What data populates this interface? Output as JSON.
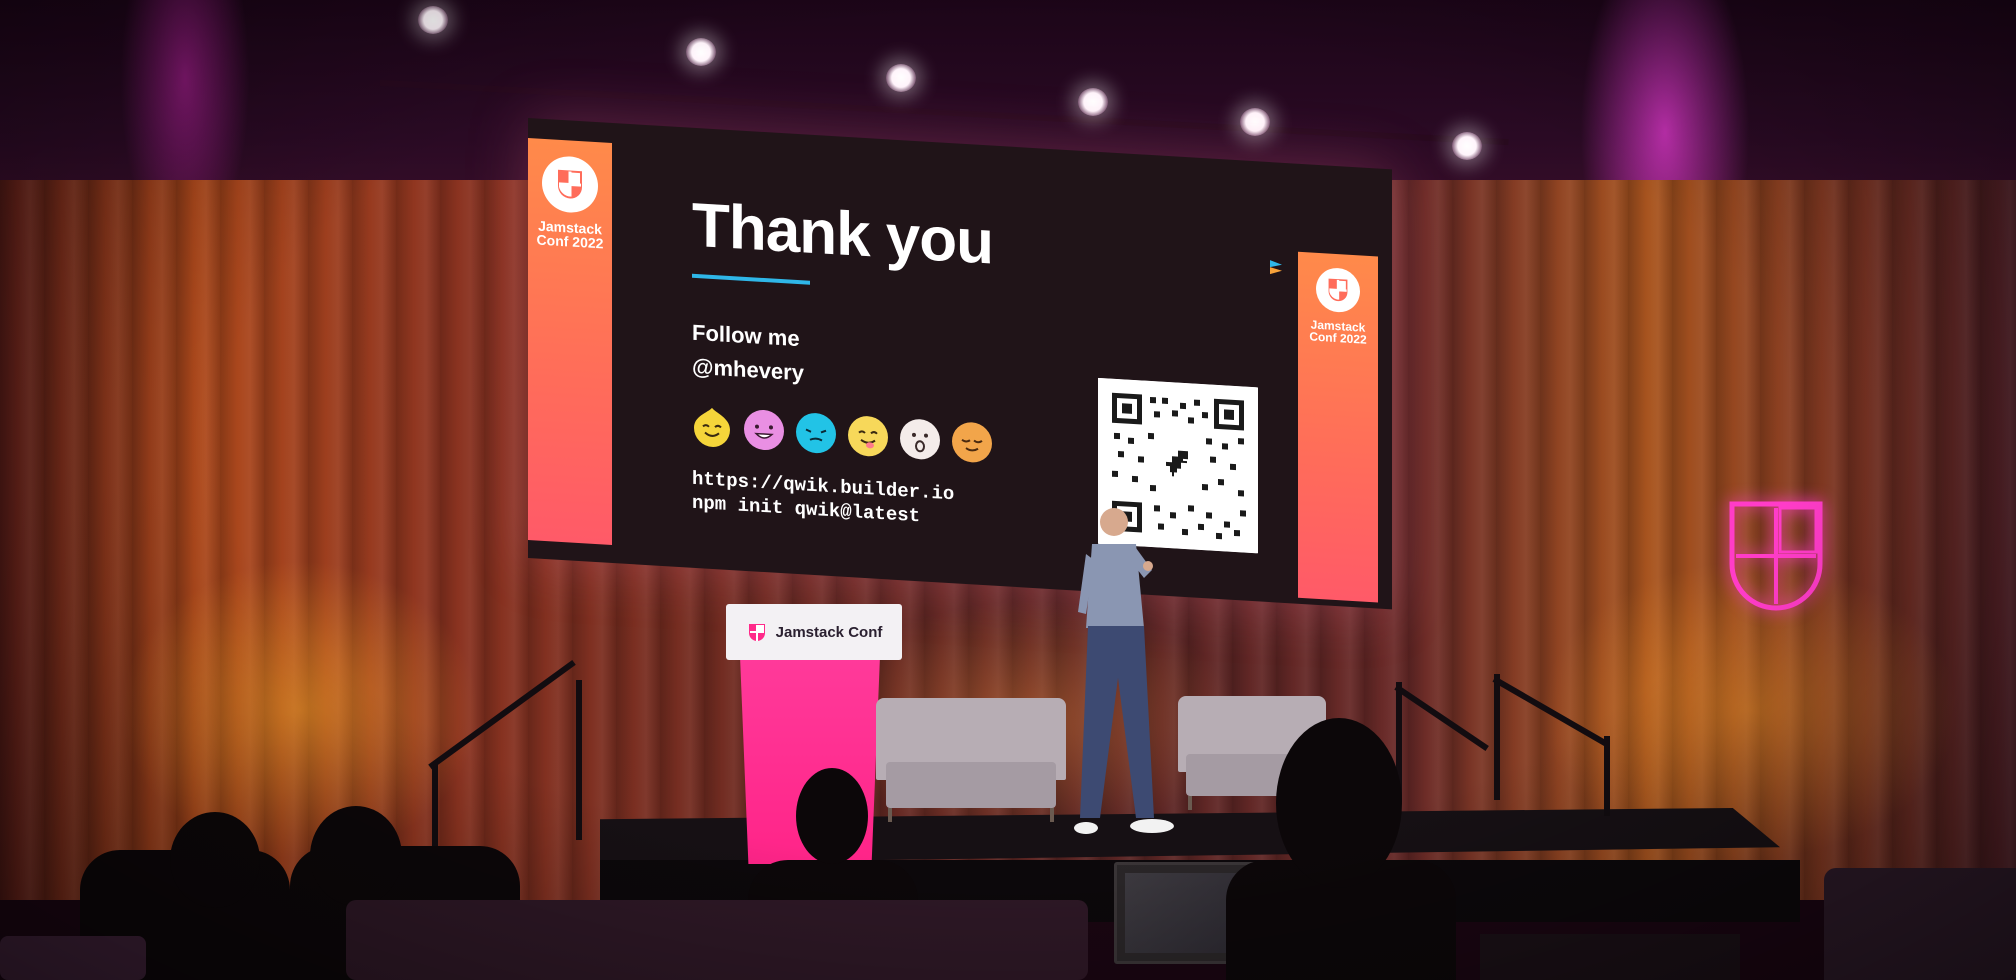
{
  "slide": {
    "title": "Thank you",
    "follow_label": "Follow me",
    "handle": "@mhevery",
    "url": "https://qwik.builder.io",
    "npm_command": "npm init qwik@latest",
    "banner_label_line1": "Jamstack",
    "banner_label_line2": "Conf 2022"
  },
  "lectern": {
    "label": "Jamstack Conf"
  },
  "colors": {
    "title_underline": "#2fb7e8",
    "banner_top": "#ff8a4a",
    "banner_bottom": "#ff5a68",
    "neon": "#ff3cc8",
    "lectern": "#ff2488",
    "screen_bg": "#201418"
  },
  "emojis": [
    {
      "icon": "yellow-face-icon",
      "color": "#f5d53a"
    },
    {
      "icon": "pink-face-icon",
      "color": "#e98fe3"
    },
    {
      "icon": "cyan-face-icon",
      "color": "#22c3e6"
    },
    {
      "icon": "yellow-tongue-face-icon",
      "color": "#f7d85a"
    },
    {
      "icon": "white-face-icon",
      "color": "#f4ecea"
    },
    {
      "icon": "orange-face-icon",
      "color": "#f2a54a"
    }
  ],
  "icons": {
    "conference_logo": "jamstack-logo-icon",
    "qr": "qr-code-icon",
    "dino": "dinosaur-icon"
  }
}
